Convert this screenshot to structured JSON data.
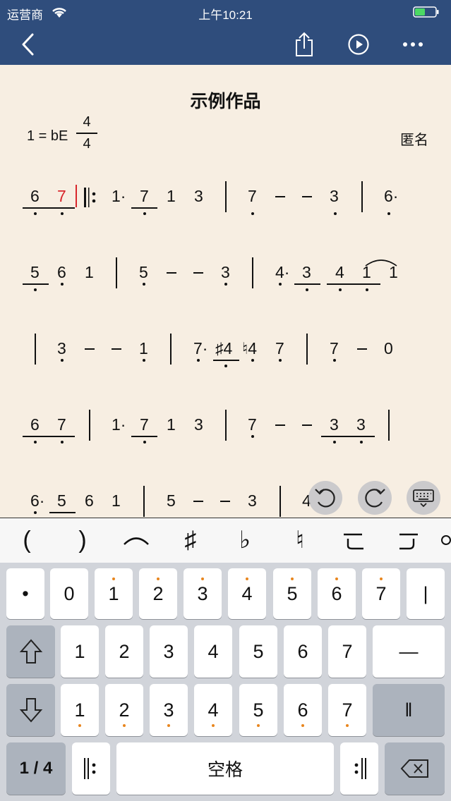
{
  "status_bar": {
    "carrier": "运营商",
    "time": "上午10:21"
  },
  "nav": {
    "back_icon": "chevron-left-icon",
    "share_icon": "share-icon",
    "play_icon": "play-icon",
    "more_icon": "more-icon"
  },
  "score": {
    "title": "示例作品",
    "key": "1 = bE",
    "time_sig_top": "4",
    "time_sig_bottom": "4",
    "author": "匿名",
    "n": {
      "six": "6",
      "seven": "7",
      "one": "1",
      "three": "3",
      "five": "5",
      "four": "4",
      "zero": "0",
      "dotted_one": "1·",
      "dotted_six": "6·",
      "dotted_four": "4·",
      "dotted_seven": "7·",
      "sharp_four": "♯4",
      "natural_four": "♮4",
      "repeat_start": "𝄆"
    }
  },
  "floating": {
    "undo_icon": "undo-icon",
    "redo_icon": "redo-icon",
    "keyboard_icon": "keyboard-icon"
  },
  "symbols": [
    "(",
    ")",
    "⌒",
    "♯",
    "♭",
    "♮",
    "ᘔ",
    "ᒧ",
    "◦"
  ],
  "keyboard": {
    "row1": [
      "•",
      "0",
      "1",
      "2",
      "3",
      "4",
      "5",
      "6",
      "7",
      "|"
    ],
    "row2": [
      "1",
      "2",
      "3",
      "4",
      "5",
      "6",
      "7",
      "—"
    ],
    "row3": [
      "1",
      "2",
      "3",
      "4",
      "5",
      "6",
      "7",
      "‖"
    ],
    "fraction": "1 / 4",
    "repeat_start": "‖:",
    "space": "空格",
    "repeat_end": ":‖",
    "shift_up_icon": "arrow-up-icon",
    "shift_down_icon": "arrow-down-icon",
    "delete_icon": "backspace-icon"
  },
  "colors": {
    "nav": "#2f4d7c",
    "paper": "#f7eee2",
    "cursor": "#d8262b",
    "octave_dot": "#e8861e"
  }
}
